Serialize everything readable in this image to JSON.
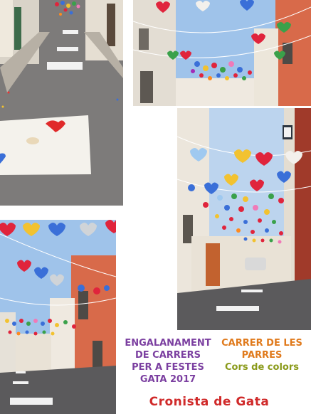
{
  "photos": [
    {
      "name": "street-floor-heart"
    },
    {
      "name": "hearts-canopy-sky"
    },
    {
      "name": "lamp-street-hearts"
    },
    {
      "name": "hearts-street-red-house"
    }
  ],
  "caption_left": [
    "ENGALANAMENT",
    "DE CARRERS",
    "PER A FESTES",
    "GATA 2017"
  ],
  "caption_right": [
    "CARRER DE LES",
    "PARRES",
    "Cors de colors"
  ],
  "credit": "Cronista de Gata",
  "colors": {
    "caption_left": "#7b3fa0",
    "caption_right_title": "#e07a1c",
    "caption_right_sub": "#8a9a1a",
    "credit": "#d02a2a"
  },
  "heart_palette": [
    "#e0243c",
    "#3a6fd8",
    "#f2c230",
    "#3aa14a",
    "#f07ab8",
    "#ff8a1e",
    "#9fc9f0",
    "#a22bb8"
  ]
}
